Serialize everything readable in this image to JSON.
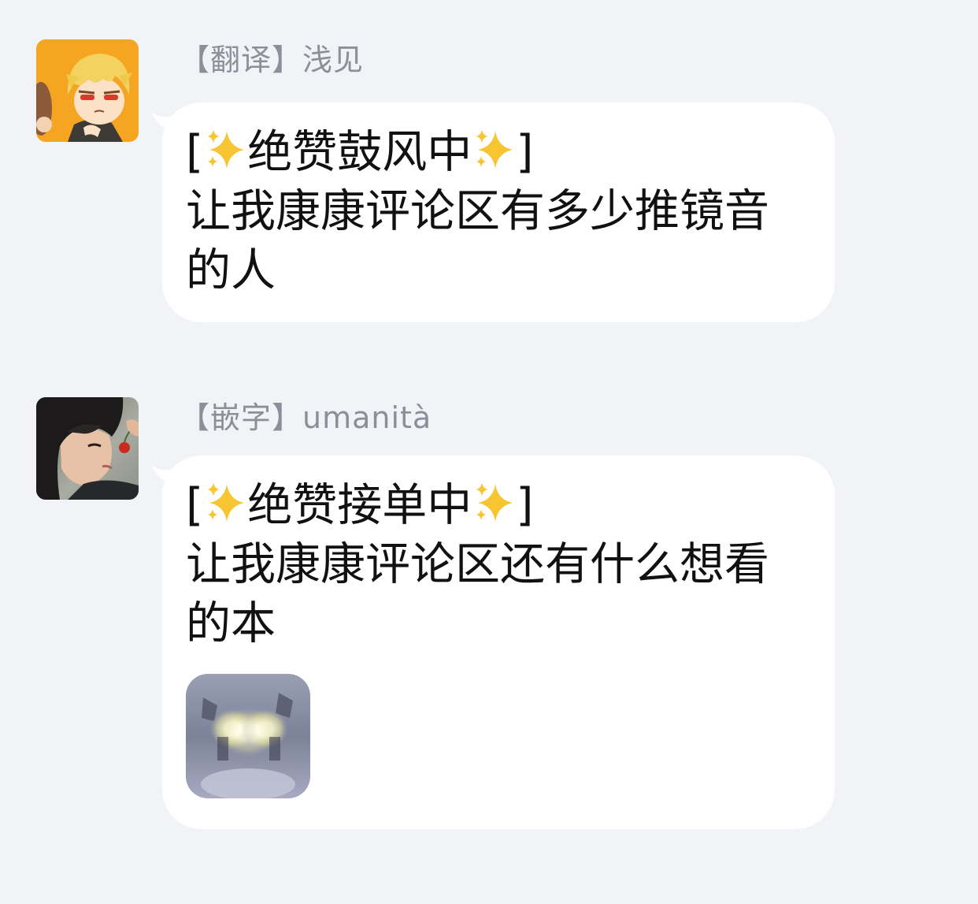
{
  "messages": [
    {
      "sender": "【翻译】浅见",
      "avatar_icon": "avatar-anime-blond-boy",
      "line1_open": "[",
      "line1_text": "绝赞鼓风中",
      "line1_close": "]",
      "line2": "让我康康评论区有多少推镜音",
      "line3": "的人",
      "sparkle_icon": "sparkles-emoji"
    },
    {
      "sender": "【嵌字】umanità",
      "avatar_icon": "avatar-dark-haired-man-cherry",
      "line1_open": "[",
      "line1_text": "绝赞接单中",
      "line1_close": "]",
      "line2": "让我康康评论区还有什么想看",
      "line3": "的本",
      "sparkle_icon": "sparkles-emoji",
      "sticker_icon": "glowing-eyes-sticker"
    }
  ],
  "colors": {
    "background": "#f2f3f7",
    "bubble": "#ffffff",
    "sender_name": "#8c8f9a",
    "message_text": "#111111"
  }
}
